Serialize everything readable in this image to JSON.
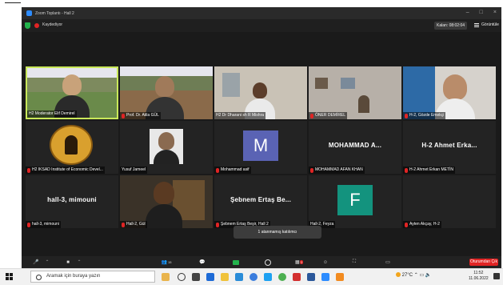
{
  "window": {
    "title": "Zoom Toplantı - Hall 2",
    "recording": "Kaydediyor",
    "timer": "Kalan: 08:02:04",
    "view_label": "Görüntüle"
  },
  "participants": [
    {
      "name": "H2 Moderator Elif Demirel",
      "type": "video",
      "active": true
    },
    {
      "name": "Prof. Dr. Atila GÜL",
      "type": "video"
    },
    {
      "name": "H2 Dr Dharani sh R Mishra",
      "type": "video"
    },
    {
      "name": "ÖNER DEMİREL",
      "type": "video"
    },
    {
      "name": "H-2, Gözde Emekçi",
      "type": "video"
    },
    {
      "name": "H2 IKSAD Institute of Economic Devel...",
      "type": "logo"
    },
    {
      "name": "Yusuf Jameel",
      "type": "photo"
    },
    {
      "name": "Mohammad asif",
      "type": "initial",
      "initial": "M",
      "color": "#5a63b4"
    },
    {
      "name": "MOHAMMAD AFAN KHAN",
      "type": "text",
      "big": "MOHAMMAD A..."
    },
    {
      "name": "H-2 Ahmet Erkan METİN",
      "type": "text",
      "big": "H-2 Ahmet Erka..."
    },
    {
      "name": "hall-3, mimouni",
      "type": "text",
      "big": "hall-3, mimouni"
    },
    {
      "name": "Hall-2, Gül",
      "type": "video"
    },
    {
      "name": "Şebnem Ertaş Beşir, Hall 2",
      "type": "text",
      "big": "Şebnem Ertaş Be..."
    },
    {
      "name": "Hall-2, Feyza",
      "type": "initial",
      "initial": "F",
      "color": "#13937e"
    },
    {
      "name": "Ayten Akçay, H-2",
      "type": "empty"
    }
  ],
  "notification": "1 atanmamış katılımcı",
  "toolbar": {
    "participants_count": "15",
    "reactions_count": "3",
    "leave_label": "Oturumdan Çık"
  },
  "taskbar": {
    "search_placeholder": "Aramak için buraya yazın",
    "temperature": "27°C",
    "time": "11:52",
    "date": "11.06.2022"
  }
}
